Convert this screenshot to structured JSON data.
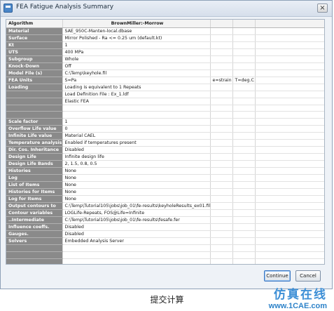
{
  "window": {
    "title": "FEA Fatigue Analysis Summary",
    "close_glyph": "×"
  },
  "table": {
    "header": {
      "label": "Algorithm",
      "value": "BrownMiller:-Morrow"
    },
    "rows": [
      {
        "label": "Material",
        "value": "SAE_950C-Manten-local.dbase",
        "extra1": "",
        "extra2": ""
      },
      {
        "label": "Surface",
        "value": "Mirror Polished - Ra <= 0.25 um (default.kt)",
        "extra1": "",
        "extra2": ""
      },
      {
        "label": "Kt",
        "value": "1",
        "extra1": "",
        "extra2": ""
      },
      {
        "label": "UTS",
        "value": "400 MPa",
        "extra1": "",
        "extra2": ""
      },
      {
        "label": "Subgroup",
        "value": "Whole",
        "extra1": "",
        "extra2": ""
      },
      {
        "label": "Knock-Down",
        "value": "Off",
        "extra1": "",
        "extra2": ""
      },
      {
        "label": "Model File (s)",
        "value": "C:\\Temp\\keyhole.fil",
        "extra1": "",
        "extra2": ""
      },
      {
        "label": "FEA Units",
        "value": "S=Pa",
        "extra1": "e=strain",
        "extra2": "T=deg.C"
      },
      {
        "label": "Loading",
        "value": "Loading is equivalent to 1 Repeats",
        "extra1": "",
        "extra2": ""
      },
      {
        "label": "",
        "value": "Load Definition File : Ex_1.ldf",
        "extra1": "",
        "extra2": ""
      },
      {
        "label": "",
        "value": "Elastic FEA",
        "extra1": "",
        "extra2": ""
      },
      {
        "label": "",
        "value": "",
        "extra1": "",
        "extra2": ""
      },
      {
        "label": "",
        "value": "",
        "extra1": "",
        "extra2": ""
      },
      {
        "label": "Scale factor",
        "value": "1",
        "extra1": "",
        "extra2": ""
      },
      {
        "label": "Overflow Life value",
        "value": "0",
        "extra1": "",
        "extra2": ""
      },
      {
        "label": "Infinite Life value",
        "value": "Material CAEL",
        "extra1": "",
        "extra2": ""
      },
      {
        "label": "Temperature analysis",
        "value": "Enabled if temperatures present",
        "extra1": "",
        "extra2": ""
      },
      {
        "label": "Dir. Cos. Inheritance",
        "value": "Disabled",
        "extra1": "",
        "extra2": ""
      },
      {
        "label": "Design Life",
        "value": "Infinite design life",
        "extra1": "",
        "extra2": ""
      },
      {
        "label": "Design Life Bands",
        "value": "2, 1.5, 0.8, 0.5",
        "extra1": "",
        "extra2": ""
      },
      {
        "label": "Histories",
        "value": "None",
        "extra1": "",
        "extra2": ""
      },
      {
        "label": "Log",
        "value": "None",
        "extra1": "",
        "extra2": ""
      },
      {
        "label": "List of Items",
        "value": "None",
        "extra1": "",
        "extra2": ""
      },
      {
        "label": "Histories for Items",
        "value": "None",
        "extra1": "",
        "extra2": ""
      },
      {
        "label": "Log for Items",
        "value": "None",
        "extra1": "",
        "extra2": ""
      },
      {
        "label": "Output contours to",
        "value": "C:\\Temp\\Tutorial105\\jobs\\job_01\\fe-results\\keyholeResults_ex01.fil",
        "extra1": "",
        "extra2": ""
      },
      {
        "label": "Contour variables",
        "value": "LOGLife-Repeats, FOS@Life=Infinite",
        "extra1": "",
        "extra2": ""
      },
      {
        "label": "..Intermediate",
        "value": "C:\\Temp\\Tutorial105\\jobs\\job_01\\fe-results\\fesafe.fer",
        "extra1": "",
        "extra2": ""
      },
      {
        "label": "Influence coeffs.",
        "value": "Disabled",
        "extra1": "",
        "extra2": ""
      },
      {
        "label": "Gauges.",
        "value": "Disabled",
        "extra1": "",
        "extra2": ""
      },
      {
        "label": "Solvers",
        "value": "Embedded Analysis Server",
        "extra1": "",
        "extra2": ""
      },
      {
        "label": "",
        "value": "",
        "extra1": "",
        "extra2": ""
      },
      {
        "label": "",
        "value": "",
        "extra1": "",
        "extra2": ""
      },
      {
        "label": "",
        "value": "",
        "extra1": "",
        "extra2": ""
      }
    ]
  },
  "buttons": {
    "continue": "Continue",
    "cancel": "Cancel"
  },
  "caption": "提交计算",
  "watermark": {
    "line1": "仿真在线",
    "line2": "www.1CAE.com"
  }
}
